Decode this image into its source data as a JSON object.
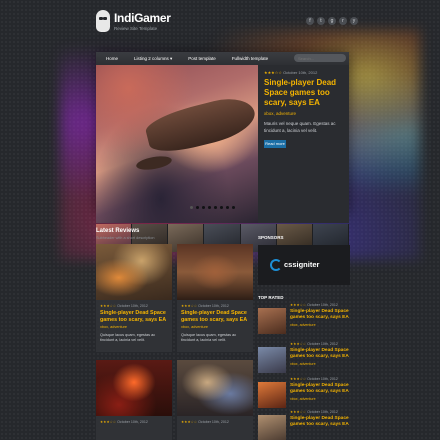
{
  "header": {
    "title": "IndiGamer",
    "subtitle": "Review Site Template",
    "social": [
      "f",
      "t",
      "g",
      "r",
      "y"
    ]
  },
  "nav": {
    "items": [
      "Home",
      "Listing 2 columns ▾",
      "Post template",
      "Fullwidth template"
    ],
    "search_placeholder": "Search..."
  },
  "slider": {
    "meta_stars": "★★★☆☆",
    "meta_date": "October 10th, 2012",
    "title": "Single-player Dead Space games too scary, says EA",
    "tags": "xbox, adventure",
    "text": "Mauris vel neque quam. Egestas ac tincidunt a, lacinia vel velit.",
    "button": "Read more"
  },
  "latest": {
    "title": "Latest Reviews",
    "subtitle": "Subheader with a short description",
    "cards": [
      {
        "stars": "★★★☆☆",
        "date": "October 10th, 2012",
        "title": "Single-player Dead Space games too scary, says EA",
        "tags": "xbox, adventure",
        "text": "Quisque lacus quam, egestas ac tincidunt a, lacinia vel velit."
      },
      {
        "stars": "★★★☆☆",
        "date": "October 10th, 2012",
        "title": "Single-player Dead Space games too scary, says EA",
        "tags": "xbox, adventure",
        "text": "Quisque lacus quam, egestas ac tincidunt a, lacinia vel velit."
      },
      {
        "stars": "★★★☆☆",
        "date": "October 10th, 2012",
        "title": "",
        "tags": "",
        "text": ""
      },
      {
        "stars": "★★★☆☆",
        "date": "October 10th, 2012",
        "title": "",
        "tags": "",
        "text": ""
      }
    ]
  },
  "sidebar": {
    "sponsors_title": "SPONSORS",
    "sponsor_name": "cssigniter",
    "top_rated_title": "TOP RATED",
    "top_items": [
      {
        "stars": "★★★☆☆",
        "date": "October 10th, 2012",
        "title": "Single-player Dead Space games too scary, says EA",
        "tags": "xbox, adventure"
      },
      {
        "stars": "★★★☆☆",
        "date": "October 10th, 2012",
        "title": "Single-player Dead Space games too scary, says EA",
        "tags": "xbox, adventure"
      },
      {
        "stars": "★★★☆☆",
        "date": "October 10th, 2012",
        "title": "Single-player Dead Space games too scary, says EA",
        "tags": "xbox, adventure"
      },
      {
        "stars": "★★★☆☆",
        "date": "October 10th, 2012",
        "title": "Single-player Dead Space games too scary, says EA",
        "tags": ""
      }
    ]
  },
  "colors": {
    "accent": "#f5b400",
    "background": "#26282c",
    "button": "#1c6fa6"
  }
}
